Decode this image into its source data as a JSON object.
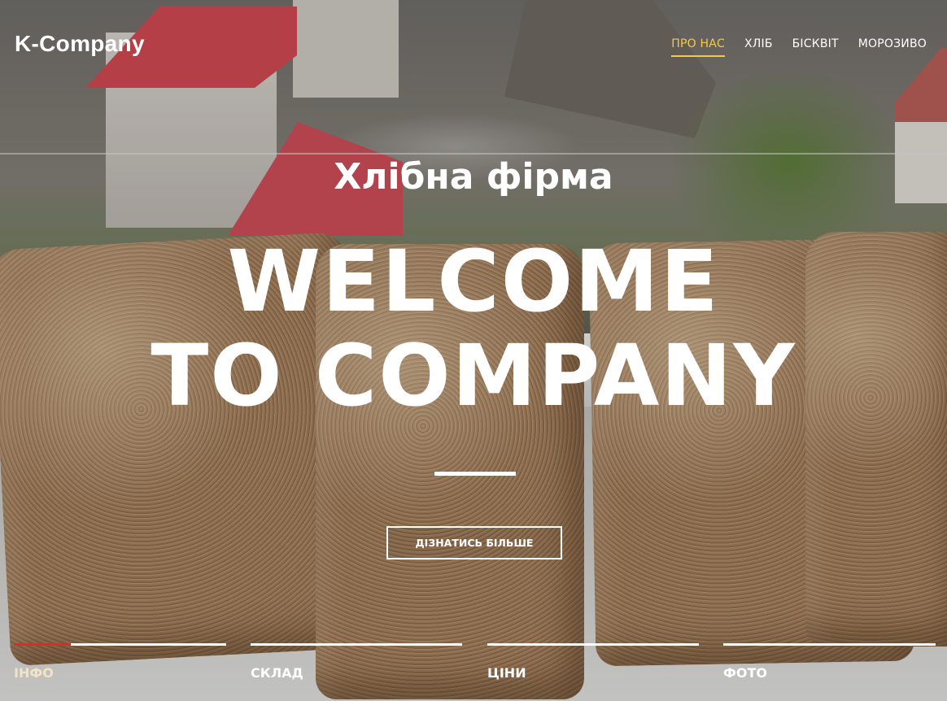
{
  "header": {
    "brand": "K-Company",
    "nav": [
      {
        "label": "ПРО НАС",
        "active": true
      },
      {
        "label": "ХЛІБ",
        "active": false
      },
      {
        "label": "БІСКВІТ",
        "active": false
      },
      {
        "label": "МОРОЗИВО",
        "active": false
      }
    ]
  },
  "hero": {
    "subtitle": "Хлібна фірма",
    "headline_line1": "WELCOME",
    "headline_line2": "TO COMPANY",
    "cta_label": "ДІЗНАТИСЬ БІЛЬШЕ"
  },
  "tabs": [
    {
      "label": "ІНФО",
      "active": true
    },
    {
      "label": "СКЛАД",
      "active": false
    },
    {
      "label": "ЦІНИ",
      "active": false
    },
    {
      "label": "ФОТО",
      "active": false
    }
  ],
  "colors": {
    "accent_nav": "#f2c94c",
    "accent_tab": "#e02a2a"
  }
}
